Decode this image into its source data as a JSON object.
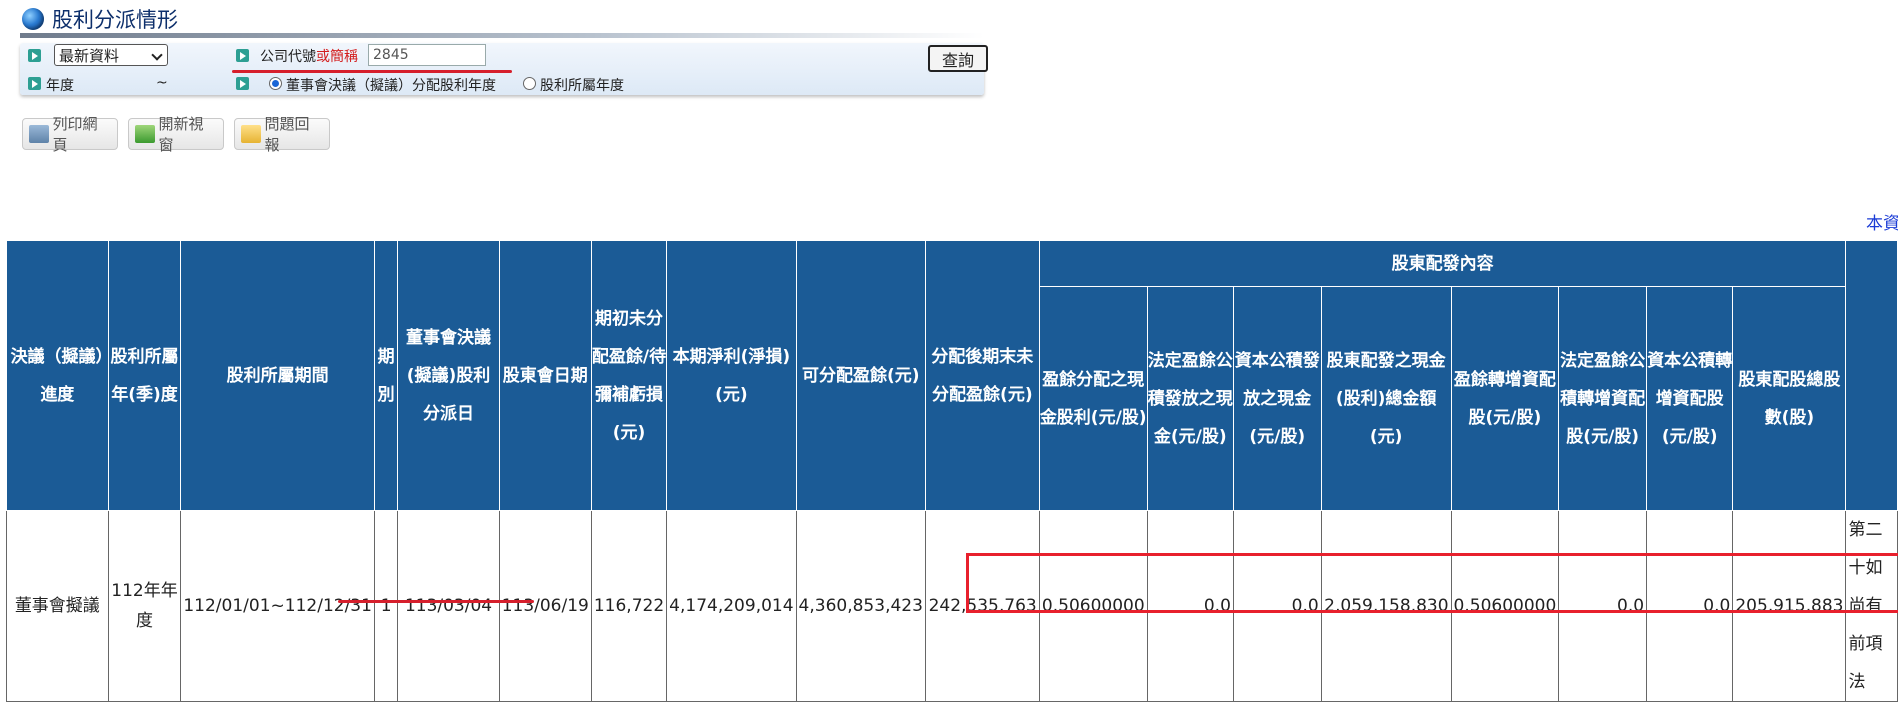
{
  "page": {
    "title": "股利分派情形"
  },
  "query": {
    "data_select": "最新資料",
    "code_label_a": "公司代號",
    "code_label_b": "或簡稱",
    "code_value": "2845",
    "year_label": "年度",
    "year_sep": "~",
    "radio_board": "董事會決議（擬議）分配股利年度",
    "radio_belong": "股利所屬年度",
    "query_button": "查詢"
  },
  "toolbar": {
    "print": "列印網頁",
    "new_window": "開新視窗",
    "report": "問題回報"
  },
  "corner_link": "本資",
  "table": {
    "headers": {
      "progress": "決議（擬議）進度",
      "belong_year": "股利所屬年(季)度",
      "belong_period": "股利所屬期間",
      "term": "期別",
      "board_date": "董事會決議(擬議)股利分派日",
      "meeting_date": "股東會日期",
      "beginning_undistributed": "期初未分配盈餘/待彌補虧損(元)",
      "net_income": "本期淨利(淨損)(元)",
      "distributable": "可分配盈餘(元)",
      "ending_undistributed": "分配後期末未分配盈餘(元)",
      "group": "股東配發內容",
      "cash_per_share": "盈餘分配之現金股利(元/股)",
      "legal_reserve_cash": "法定盈餘公積發放之現金(元/股)",
      "capital_reserve_cash": "資本公積發放之現金(元/股)",
      "total_cash": "股東配發之現金(股利)總金額(元)",
      "stock_per_share": "盈餘轉增資配股(元/股)",
      "legal_reserve_stock": "法定盈餘公積轉增資配股(元/股)",
      "capital_reserve_stock": "資本公積轉增資配股(元/股)",
      "total_shares": "股東配股總股數(股)"
    },
    "row": {
      "progress": "董事會擬議",
      "belong_year": "112年年度",
      "belong_period": "112/01/01~112/12/31",
      "term": "1",
      "board_date": "113/03/04",
      "meeting_date": "113/06/19",
      "beginning_undistributed": "116,722",
      "net_income": "4,174,209,014",
      "distributable": "4,360,853,423",
      "ending_undistributed": "242,535,763",
      "cash_per_share": "0.50600000",
      "legal_reserve_cash": "0.0",
      "capital_reserve_cash": "0.0",
      "total_cash": "2,059,158,830",
      "stock_per_share": "0.50600000",
      "legal_reserve_stock": "0.0",
      "capital_reserve_stock": "0.0",
      "total_shares": "205,915,883",
      "note": "第二十如尚有前項法"
    }
  },
  "colors": {
    "header_bg": "#1b5b96",
    "highlight": "#e8202d",
    "link": "#1a3bd6"
  },
  "icons": [
    "globe-icon",
    "arrow-icon",
    "printer-icon",
    "new-window-icon",
    "mail-icon"
  ]
}
